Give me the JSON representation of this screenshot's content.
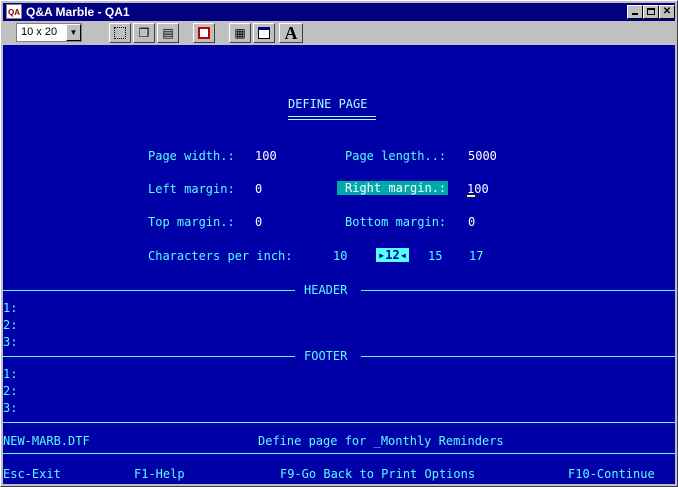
{
  "window": {
    "app_icon_text": "QA",
    "title": "Q&A Marble - QA1",
    "min_icon": "minimize-icon",
    "max_icon": "maximize-icon",
    "close_icon": "close-icon"
  },
  "toolbar": {
    "font_size_value": "10 x 20",
    "font_label": "A",
    "buttons": [
      "mark-icon",
      "copy-icon",
      "paste-icon",
      "full-screen-icon",
      "properties-icon",
      "background-icon",
      "font-icon"
    ]
  },
  "screen": {
    "title": "DEFINE PAGE",
    "fields": {
      "page_width_label": "Page width.:",
      "page_width_value": "100",
      "page_length_label": "Page length..:",
      "page_length_value": "5000",
      "left_margin_label": "Left margin:",
      "left_margin_value": "0",
      "right_margin_label": "Right margin.:",
      "right_margin_value": "100",
      "top_margin_label": "Top margin.:",
      "top_margin_value": "0",
      "bottom_margin_label": "Bottom margin:",
      "bottom_margin_value": "0",
      "cpi_label": "Characters per inch:",
      "cpi_options": [
        "10",
        "12",
        "15",
        "17"
      ],
      "cpi_selected": "12"
    },
    "header_title": "HEADER",
    "footer_title": "FOOTER",
    "header_lines": [
      "1:",
      "2:",
      "3:"
    ],
    "footer_lines": [
      "1:",
      "2:",
      "3:"
    ],
    "status": {
      "filename": "NEW-MARB.DTF",
      "message": "Define page for _Monthly Reminders"
    },
    "keys": {
      "esc": "Esc-Exit",
      "f1": "F1-Help",
      "f9": "F9-Go Back to Print Options",
      "f10": "F10-Continue"
    }
  }
}
